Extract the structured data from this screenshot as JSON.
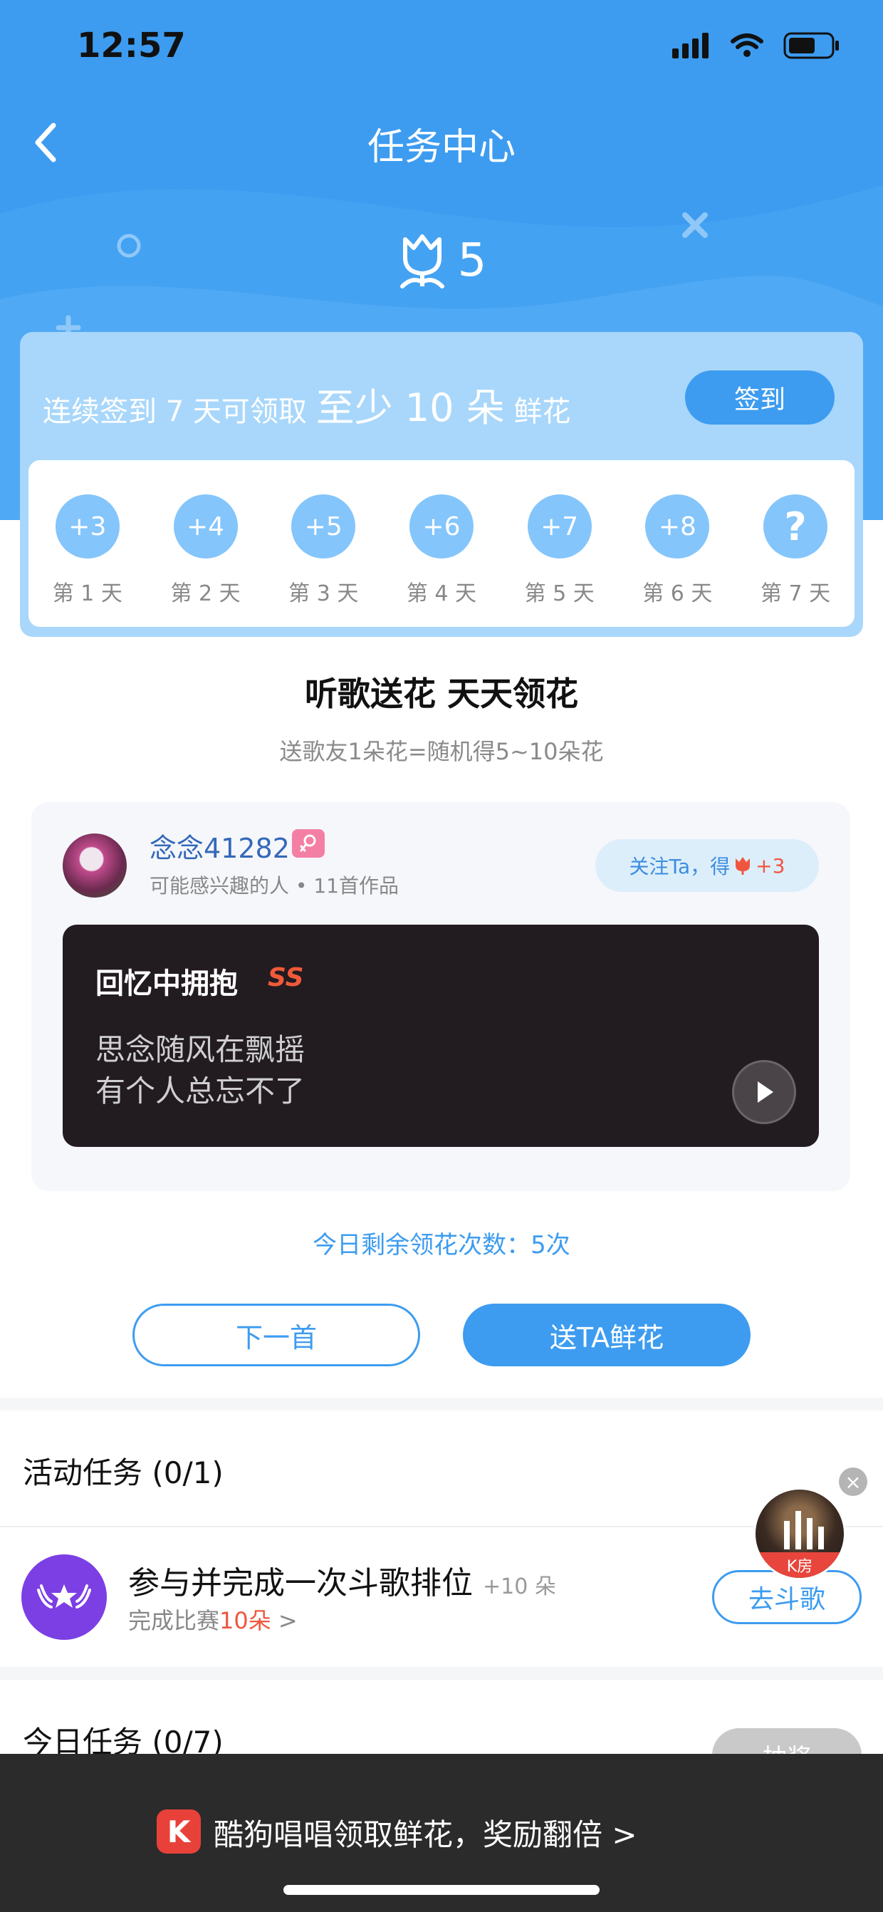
{
  "status_bar": {
    "time": "12:57"
  },
  "nav": {
    "title": "任务中心"
  },
  "flowers": {
    "count": "5"
  },
  "signin": {
    "text_prefix": "连续签到 7 天可领取",
    "text_highlight": "至少 10 朵",
    "text_suffix": "鲜花",
    "button": "签到",
    "days": [
      {
        "bonus": "+3",
        "label": "第 1 天"
      },
      {
        "bonus": "+4",
        "label": "第 2 天"
      },
      {
        "bonus": "+5",
        "label": "第 3 天"
      },
      {
        "bonus": "+6",
        "label": "第 4 天"
      },
      {
        "bonus": "+7",
        "label": "第 5 天"
      },
      {
        "bonus": "+8",
        "label": "第 6 天"
      },
      {
        "bonus": "?",
        "label": "第 7 天"
      }
    ]
  },
  "promo": {
    "headline": "听歌送花 天天领花",
    "subline": "送歌友1朵花=随机得5~10朵花"
  },
  "recommend": {
    "username": "念念41282",
    "meta": "可能感兴趣的人 • 11首作品",
    "follow_text": "关注Ta，得",
    "follow_bonus": "+3",
    "song_title": "回忆中拥抱",
    "song_tag": "SS",
    "lyric_line1": "思念随风在飘摇",
    "lyric_line2": "有个人总忘不了"
  },
  "remaining": "今日剩余领花次数：5次",
  "actions": {
    "next": "下一首",
    "send": "送TA鲜花"
  },
  "activity_tasks": {
    "title": "活动任务 (0/1)",
    "task_title": "参与并完成一次斗歌排位",
    "task_reward": "+10 朵",
    "task_sub_prefix": "完成比赛",
    "task_sub_highlight": "10朵",
    "task_sub_suffix": " >",
    "button": "去斗歌"
  },
  "today_tasks": {
    "title": "今日任务 (0/7)",
    "button": "抽奖"
  },
  "floating_room": {
    "label": "K房"
  },
  "banner": {
    "logo": "K",
    "text": "酷狗唱唱领取鲜花，奖励翻倍 >"
  },
  "colors": {
    "primary": "#3d9cf0",
    "accent_red": "#f0563f",
    "purple": "#7b3fe4"
  }
}
